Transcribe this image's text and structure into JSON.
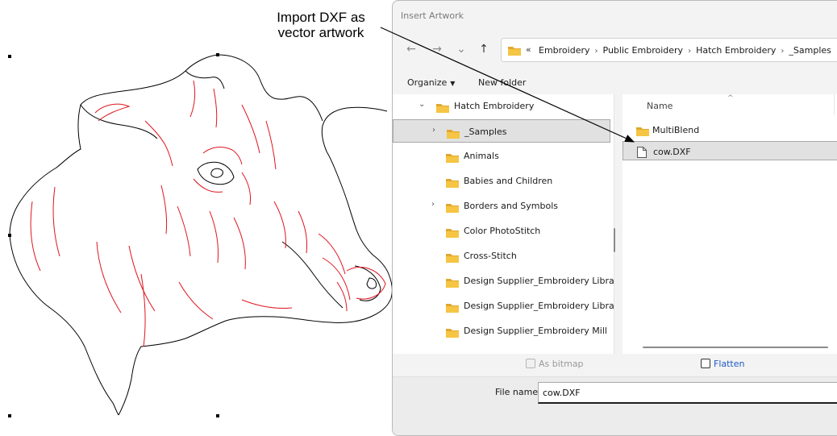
{
  "callout": {
    "line1": "Import DXF as",
    "line2": "vector artwork"
  },
  "dialog": {
    "title": "Insert Artwork",
    "nav": {
      "back_icon": "arrow-left-icon",
      "forward_icon": "arrow-right-icon",
      "recent_icon": "chevron-down-icon",
      "up_icon": "arrow-up-icon"
    },
    "address": {
      "overflow": "«",
      "crumbs": [
        "Embroidery",
        "Public Embroidery",
        "Hatch Embroidery",
        "_Samples"
      ],
      "separator": "›"
    },
    "toolbar": {
      "organize": "Organize",
      "new_folder": "New folder"
    },
    "tree": [
      {
        "label": "Hatch Embroidery",
        "expander": "⌄",
        "level": 0,
        "selected": false
      },
      {
        "label": "_Samples",
        "expander": "›",
        "level": 1,
        "selected": true
      },
      {
        "label": "Animals",
        "expander": "",
        "level": 1,
        "selected": false
      },
      {
        "label": "Babies and Children",
        "expander": "",
        "level": 1,
        "selected": false
      },
      {
        "label": "Borders and Symbols",
        "expander": "›",
        "level": 1,
        "selected": false
      },
      {
        "label": "Color PhotoStitch",
        "expander": "",
        "level": 1,
        "selected": false
      },
      {
        "label": "Cross-Stitch",
        "expander": "",
        "level": 1,
        "selected": false
      },
      {
        "label": "Design Supplier_Embroidery Library",
        "expander": "",
        "level": 1,
        "selected": false
      },
      {
        "label": "Design Supplier_Embroidery Library",
        "expander": "",
        "level": 1,
        "selected": false
      },
      {
        "label": "Design Supplier_Embroidery Mill",
        "expander": "",
        "level": 1,
        "selected": false
      }
    ],
    "list": {
      "column_name": "Name",
      "sort_indicator": "^",
      "items": [
        {
          "label": "MultiBlend",
          "type": "folder",
          "selected": false
        },
        {
          "label": "cow.DXF",
          "type": "file",
          "selected": true
        }
      ]
    },
    "options": {
      "as_bitmap": "As bitmap",
      "flatten": "Flatten"
    },
    "file_name": {
      "label": "File name:",
      "value": "cow.DXF"
    },
    "colors": {
      "folder": "#f5c543",
      "folder_tab": "#e0a82e",
      "selection": "#e1e1e1",
      "accent": "#1d5ac4"
    }
  },
  "artwork": {
    "outline_color": "#000000",
    "detail_color": "#e0141e"
  }
}
